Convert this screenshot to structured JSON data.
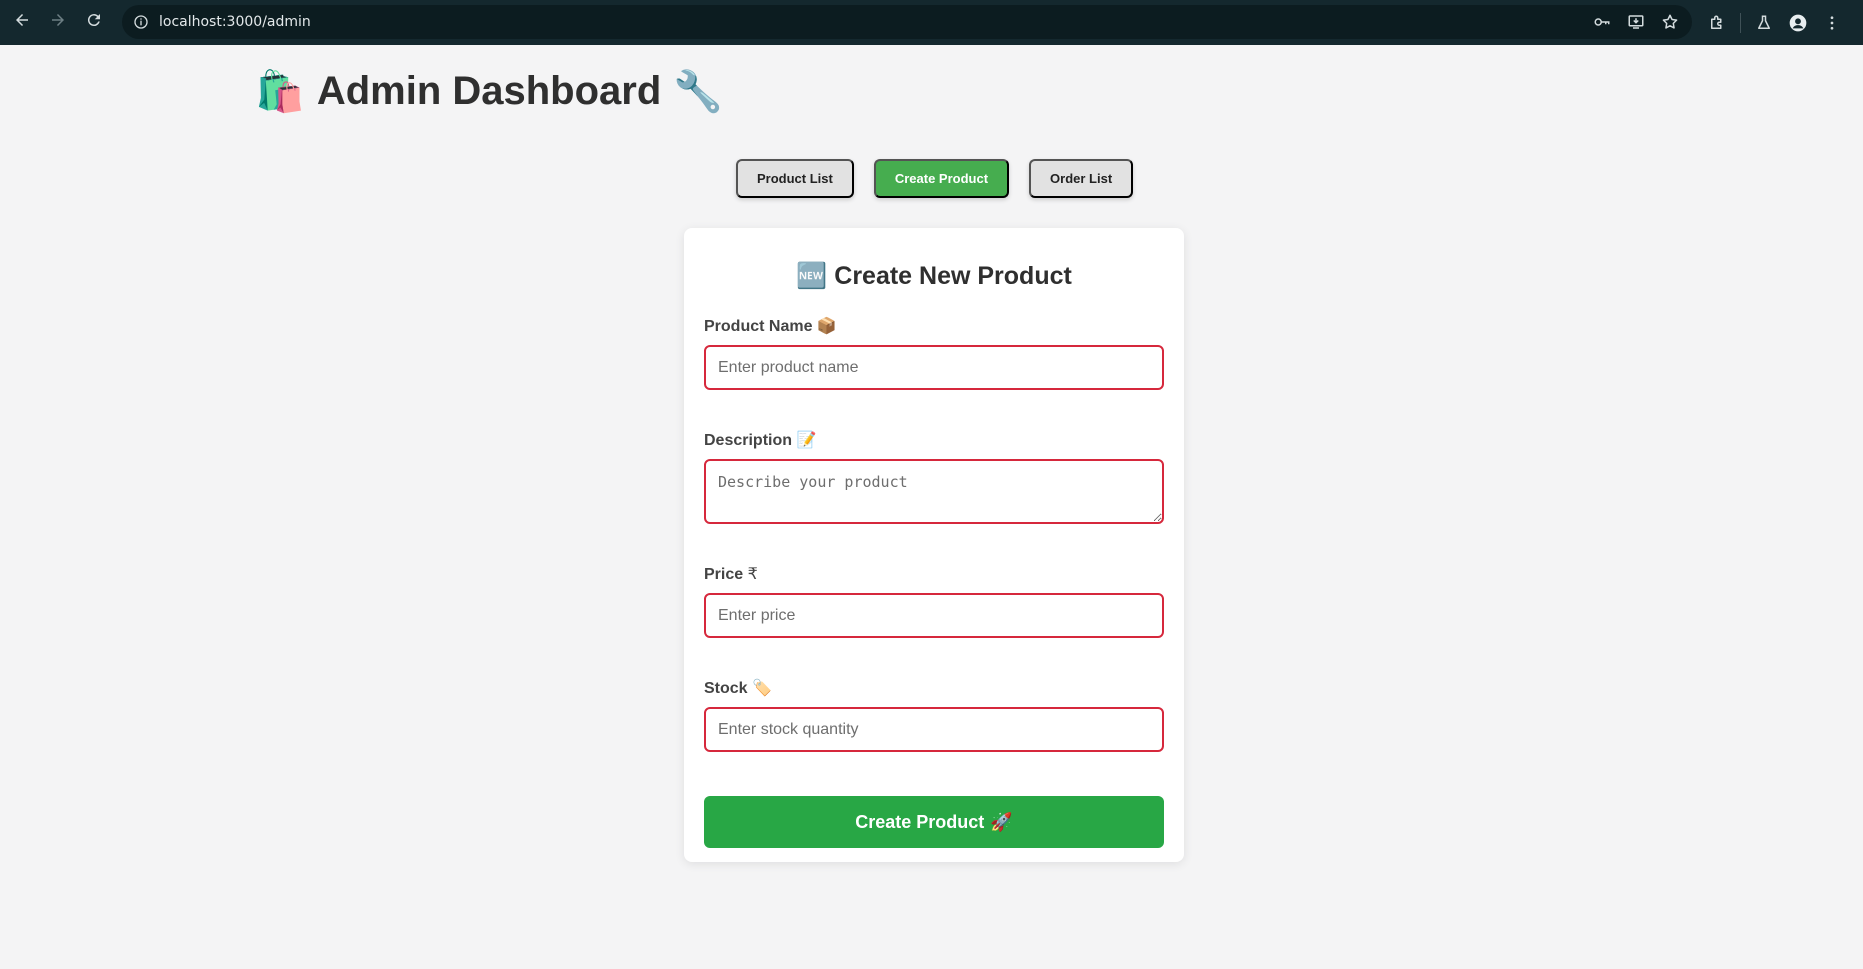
{
  "browser": {
    "url": "localhost:3000/admin",
    "icons": {
      "back": "arrow-left-icon",
      "forward": "arrow-right-icon",
      "reload": "reload-icon",
      "site_info": "info-icon",
      "password": "key-icon",
      "install": "install-app-icon",
      "bookmark": "star-icon",
      "extensions": "puzzle-icon",
      "labs": "flask-icon",
      "profile": "profile-icon",
      "menu": "kebab-menu-icon"
    }
  },
  "header": {
    "title": "Admin Dashboard",
    "leading_emoji": "🛍️",
    "trailing_emoji": "🔧"
  },
  "tabs": [
    {
      "label": "Product List",
      "active": false
    },
    {
      "label": "Create Product",
      "active": true
    },
    {
      "label": "Order List",
      "active": false
    }
  ],
  "form": {
    "title_emoji": "🆕",
    "title": "Create New Product",
    "fields": {
      "name": {
        "label": "Product Name",
        "emoji": "📦",
        "placeholder": "Enter product name",
        "value": ""
      },
      "description": {
        "label": "Description",
        "emoji": "📝",
        "placeholder": "Describe your product",
        "value": ""
      },
      "price": {
        "label": "Price",
        "emoji": "₹",
        "placeholder": "Enter price",
        "value": ""
      },
      "stock": {
        "label": "Stock",
        "emoji": "🏷️",
        "placeholder": "Enter stock quantity",
        "value": ""
      }
    },
    "submit_label": "Create Product",
    "submit_emoji": "🚀"
  },
  "colors": {
    "browser_bar": "#14282e",
    "page_bg": "#f4f4f5",
    "active_tab": "#46ad4f",
    "inactive_tab": "#e2e2e2",
    "input_border": "#d6283c",
    "submit_button": "#28a745"
  }
}
